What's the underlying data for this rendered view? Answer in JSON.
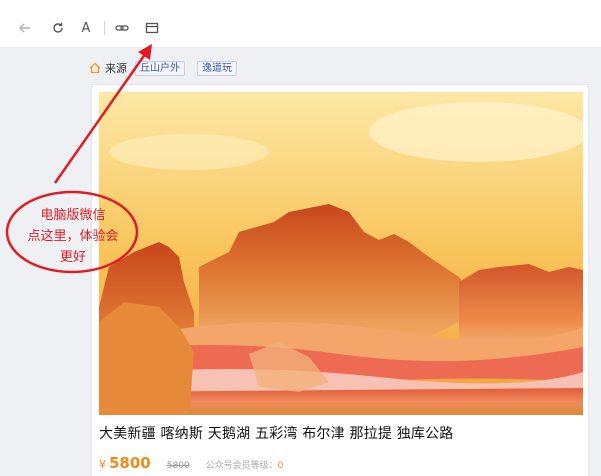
{
  "toolbar": {
    "buttons": [
      {
        "name": "back-button",
        "icon": "arrow-left-icon"
      },
      {
        "name": "refresh-button",
        "icon": "refresh-icon"
      },
      {
        "name": "font-button",
        "icon": "font-icon",
        "glyph": "A"
      },
      {
        "name": "copy-link-button",
        "icon": "link-icon"
      },
      {
        "name": "open-browser-button",
        "icon": "window-icon"
      }
    ]
  },
  "source": {
    "label": "来源",
    "tags": [
      "丘山户外",
      "逸道玩"
    ]
  },
  "article": {
    "title": "大美新疆 喀纳斯 天鹅湖 五彩湾 布尔津 那拉提 独库公路",
    "currency": "¥",
    "price": "5800",
    "original_price": "5800",
    "member_label": "公众号会员等级：",
    "member_value": "0"
  },
  "annotation": {
    "lines": [
      "电脑版微信",
      "点这里，体验会",
      "更好"
    ],
    "color": "#e01b24"
  },
  "colors": {
    "accent": "#f28a1a",
    "tag_text": "#3b5aa8",
    "annotation": "#e01b24"
  }
}
